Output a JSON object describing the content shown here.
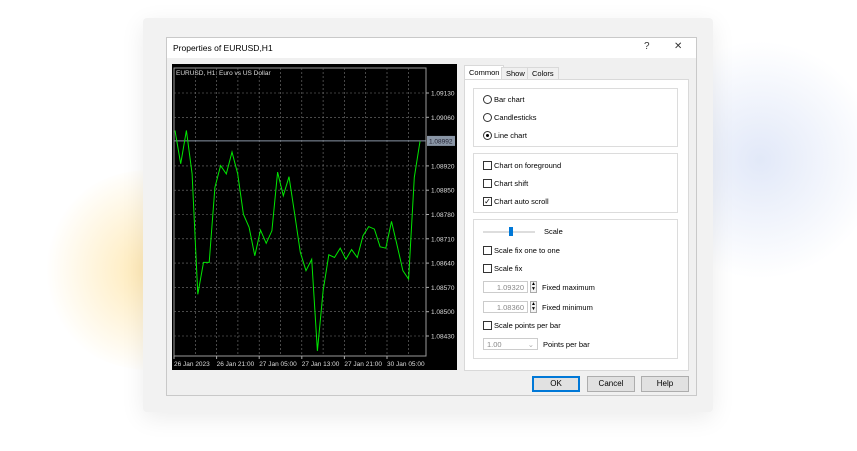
{
  "dialog": {
    "title": "Properties of EURUSD,H1",
    "help_label": "?",
    "close_label": "✕"
  },
  "chart_data": {
    "type": "line",
    "title": "EURUSD, H1: Euro vs US Dollar",
    "line_color": "#00e600",
    "background": "#000000",
    "grid": true,
    "current_price": "1.08992",
    "y_ticks": [
      "1.09130",
      "1.09060",
      "1.08920",
      "1.08850",
      "1.08780",
      "1.08710",
      "1.08640",
      "1.08570",
      "1.08500",
      "1.08430"
    ],
    "ylim": [
      1.0837,
      1.0917
    ],
    "x_ticks": [
      "26 Jan 2023",
      "26 Jan 21:00",
      "27 Jan 05:00",
      "27 Jan 13:00",
      "27 Jan 21:00",
      "30 Jan 05:00"
    ],
    "values": [
      1.09022,
      1.08926,
      1.09022,
      1.08897,
      1.0855,
      1.08642,
      1.08642,
      1.08858,
      1.08921,
      1.08897,
      1.0896,
      1.08897,
      1.08781,
      1.08743,
      1.08661,
      1.08735,
      1.08697,
      1.08733,
      1.08902,
      1.08834,
      1.08889,
      1.08781,
      1.08671,
      1.08618,
      1.08651,
      1.08387,
      1.0856,
      1.08664,
      1.08656,
      1.08683,
      1.08651,
      1.08679,
      1.08656,
      1.08719,
      1.08745,
      1.08738,
      1.08687,
      1.08683,
      1.0876,
      1.0869,
      1.08618,
      1.08594,
      1.08887,
      1.08991
    ]
  },
  "tabs": [
    "Common",
    "Show",
    "Colors"
  ],
  "chart_type": {
    "options": [
      "Bar chart",
      "Candlesticks",
      "Line chart"
    ],
    "selected": 2
  },
  "checks": [
    {
      "label": "Chart on foreground",
      "checked": false
    },
    {
      "label": "Chart shift",
      "checked": false
    },
    {
      "label": "Chart auto scroll",
      "checked": true
    }
  ],
  "scale": {
    "label": "Scale",
    "level": 0.55,
    "fix_one": {
      "label": "Scale fix one to one",
      "checked": false
    },
    "fix": {
      "label": "Scale fix",
      "checked": false
    },
    "max": {
      "value": "1.09320",
      "label": "Fixed maximum"
    },
    "min": {
      "value": "1.08360",
      "label": "Fixed minimum"
    },
    "ppb": {
      "label": "Scale points per bar",
      "checked": false
    },
    "ppb_value": {
      "value": "1.00",
      "label": "Points per bar"
    }
  },
  "buttons": {
    "ok": "OK",
    "cancel": "Cancel",
    "help": "Help"
  },
  "accent": "#0078d7"
}
